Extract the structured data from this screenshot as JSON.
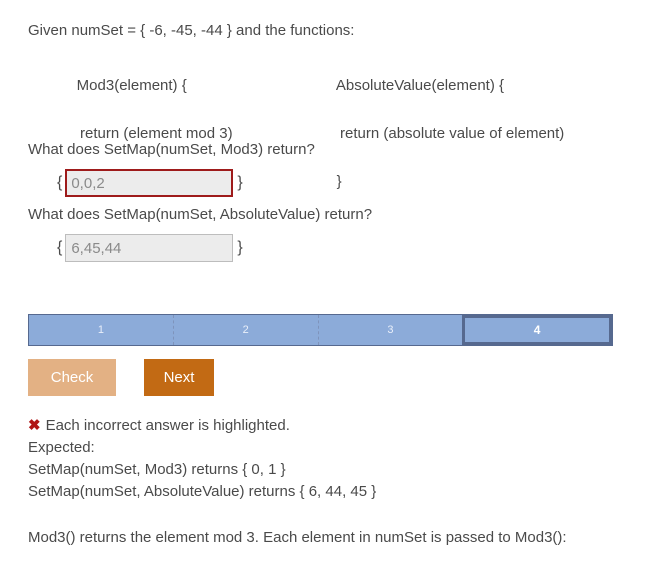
{
  "prompt": {
    "given_line": "Given numSet = { -6, -45, -44 } and the functions:",
    "functions": [
      {
        "signature": "Mod3(element) {",
        "body": "return (element mod 3)",
        "close": "}"
      },
      {
        "signature": "AbsoluteValue(element) {",
        "body": "return (absolute value of element)",
        "close": "}"
      }
    ]
  },
  "questions": [
    {
      "text": "What does SetMap(numSet, Mod3) return?",
      "brace_open": "{",
      "brace_close": "}",
      "answer_value": "0,0,2",
      "state": "incorrect"
    },
    {
      "text": "What does SetMap(numSet, AbsoluteValue) return?",
      "brace_open": "{",
      "brace_close": "}",
      "answer_value": "6,45,44",
      "state": "neutral"
    }
  ],
  "progress": {
    "steps": [
      {
        "label": "1",
        "active": false
      },
      {
        "label": "2",
        "active": false
      },
      {
        "label": "3",
        "active": false
      },
      {
        "label": "4",
        "active": true
      }
    ],
    "current": 4,
    "total": 4
  },
  "buttons": {
    "check_label": "Check",
    "next_label": "Next"
  },
  "feedback": {
    "x_icon": "✖",
    "headline": "Each incorrect answer is highlighted.",
    "expected_label": "Expected:",
    "expected_lines": [
      "SetMap(numSet, Mod3) returns { 0, 1 }",
      "SetMap(numSet, AbsoluteValue) returns { 6, 44, 45 }"
    ],
    "explanation": "Mod3() returns the element mod 3. Each element in numSet is passed to Mod3():"
  },
  "colors": {
    "text": "#4a4a4a",
    "incorrect_border": "#9e1b1b",
    "x_mark": "#b01515",
    "progress_fill": "#8cabd9",
    "progress_border": "#56698f",
    "check_button": "#e3b184",
    "next_button": "#c26a14",
    "input_background": "#ececec"
  }
}
